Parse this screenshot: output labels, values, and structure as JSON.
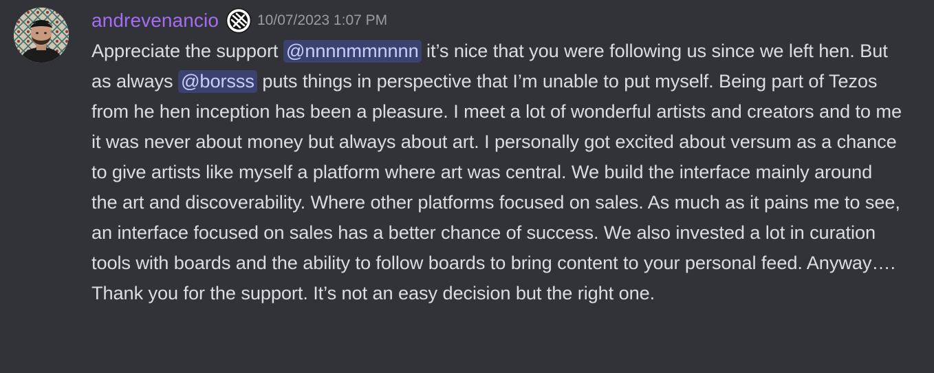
{
  "message": {
    "author": {
      "username": "andrevenancio",
      "username_color": "#a56ef2",
      "avatar_icon": "user-avatar-photo",
      "badge_icon": "crossed-circle-badge-icon"
    },
    "timestamp": "10/07/2023 1:07 PM",
    "body": {
      "segment_1": "Appreciate the support ",
      "mention_1": "@nnnnmmnnnn",
      "segment_2": " it’s nice that you were following us since we left hen. But as always ",
      "mention_2": "@borsss",
      "segment_3": " puts things in perspective that I’m unable to put myself. Being part of Tezos from he hen inception has been a pleasure. I meet a lot of wonderful artists and creators and to me it was never about money but always about art. I personally got excited about versum as a chance to give artists like myself a platform where art was central. We build the interface mainly around the art and discoverability. Where other platforms focused on sales. As much as it pains me to see, an interface focused on sales has a better chance of success. We also invested a lot in curation tools with boards and the ability to follow boards to bring content to your personal feed. Anyway…. Thank you for the support. It’s not an easy decision but the right one."
    }
  },
  "colors": {
    "background": "#313338",
    "text": "#dbdee1",
    "timestamp": "#9a9ca3",
    "mention_bg": "#3c4270",
    "mention_text": "#c9cdfb"
  }
}
